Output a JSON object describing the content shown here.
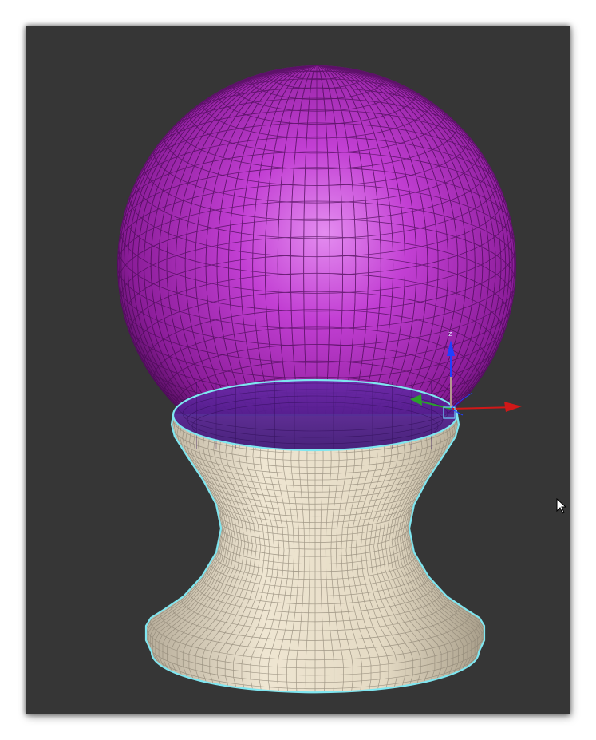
{
  "viewport": {
    "background_color": "#363636",
    "selection_color": "#7fe6f0"
  },
  "scene": {
    "sphere": {
      "color": "#b42bc4",
      "highlight_color": "#d978e4"
    },
    "pedestal": {
      "color": "#e6dcc8",
      "wire_color": "#ffffff"
    }
  },
  "gizmo": {
    "z_label": "z",
    "x_color": "#d01818",
    "y_color": "#2aa02a",
    "z_color": "#2040ff"
  },
  "cursor": {
    "icon": "arrow-cursor-icon"
  }
}
